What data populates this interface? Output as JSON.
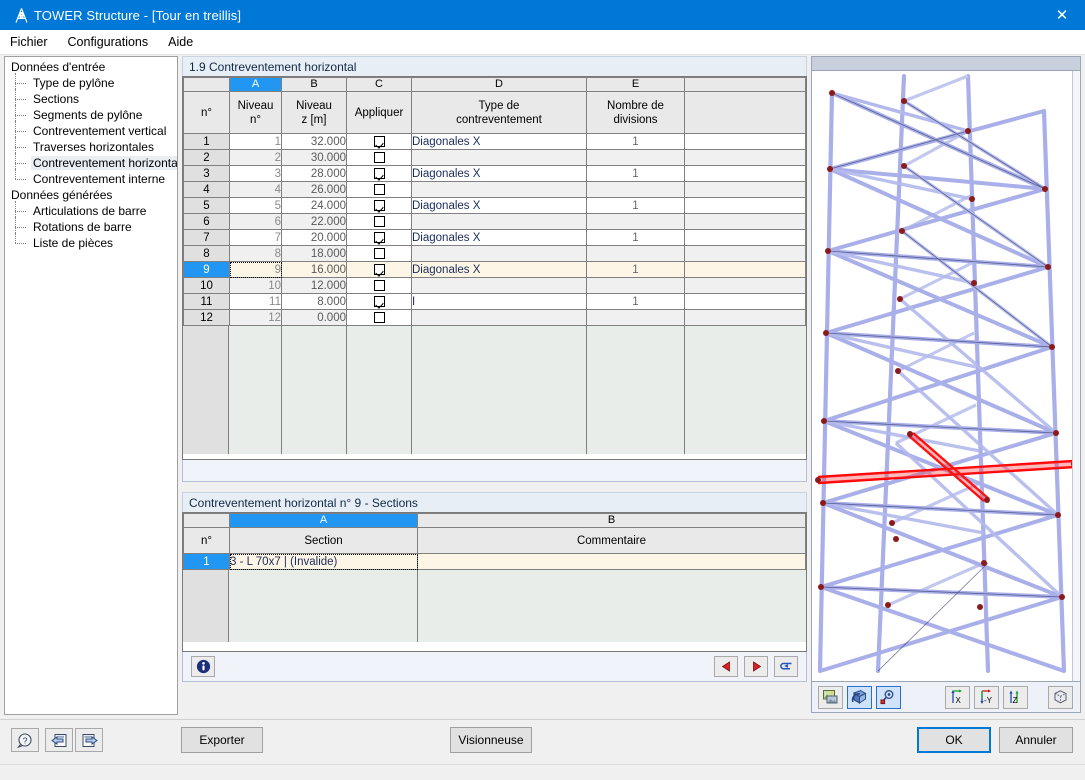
{
  "window": {
    "title": "TOWER Structure - [Tour en treillis]",
    "icon": "tower-icon",
    "close_label": "✕",
    "titlebar_color": "#0078d7"
  },
  "menu": {
    "items": [
      {
        "label": "Fichier",
        "name": "menu-fichier"
      },
      {
        "label": "Configurations",
        "name": "menu-configurations"
      },
      {
        "label": "Aide",
        "name": "menu-aide"
      }
    ]
  },
  "sidebar": {
    "groups": [
      {
        "label": "Données d'entrée",
        "items": [
          {
            "label": "Type de pylône",
            "selected": false
          },
          {
            "label": "Sections",
            "selected": false
          },
          {
            "label": "Segments de pylône",
            "selected": false
          },
          {
            "label": "Contreventement vertical",
            "selected": false
          },
          {
            "label": "Traverses horizontales",
            "selected": false
          },
          {
            "label": "Contreventement horizontal",
            "selected": true
          },
          {
            "label": "Contreventement interne",
            "selected": false
          }
        ]
      },
      {
        "label": "Données générées",
        "items": [
          {
            "label": "Articulations de barre",
            "selected": false
          },
          {
            "label": "Rotations de barre",
            "selected": false
          },
          {
            "label": "Liste de pièces",
            "selected": false
          }
        ]
      }
    ]
  },
  "main": {
    "section_title": "1.9 Contreventement horizontal",
    "grid": {
      "column_letters": [
        "",
        "A",
        "B",
        "C",
        "D",
        "E",
        ""
      ],
      "selected_column_letter": "A",
      "headers": {
        "rownum": "n°",
        "a_line1": "Niveau",
        "a_line2": "n°",
        "b_line1": "Niveau",
        "b_line2": "z [m]",
        "c_line1": "",
        "c_line2": "Appliquer",
        "d_line1": "Type de",
        "d_line2": "contreventement",
        "e_line1": "Nombre de",
        "e_line2": "divisions",
        "f": ""
      },
      "rows": [
        {
          "n": "1",
          "niveau": "1",
          "z": "32.000",
          "appliquer": true,
          "type": "Diagonales X",
          "divisions": "1",
          "selected": false
        },
        {
          "n": "2",
          "niveau": "2",
          "z": "30.000",
          "appliquer": false,
          "type": "",
          "divisions": "",
          "selected": false
        },
        {
          "n": "3",
          "niveau": "3",
          "z": "28.000",
          "appliquer": true,
          "type": "Diagonales X",
          "divisions": "1",
          "selected": false
        },
        {
          "n": "4",
          "niveau": "4",
          "z": "26.000",
          "appliquer": false,
          "type": "",
          "divisions": "",
          "selected": false
        },
        {
          "n": "5",
          "niveau": "5",
          "z": "24.000",
          "appliquer": true,
          "type": "Diagonales X",
          "divisions": "1",
          "selected": false
        },
        {
          "n": "6",
          "niveau": "6",
          "z": "22.000",
          "appliquer": false,
          "type": "",
          "divisions": "",
          "selected": false
        },
        {
          "n": "7",
          "niveau": "7",
          "z": "20.000",
          "appliquer": true,
          "type": "Diagonales X",
          "divisions": "1",
          "selected": false
        },
        {
          "n": "8",
          "niveau": "8",
          "z": "18.000",
          "appliquer": false,
          "type": "",
          "divisions": "",
          "selected": false
        },
        {
          "n": "9",
          "niveau": "9",
          "z": "16.000",
          "appliquer": true,
          "type": "Diagonales X",
          "divisions": "1",
          "selected": true
        },
        {
          "n": "10",
          "niveau": "10",
          "z": "12.000",
          "appliquer": false,
          "type": "",
          "divisions": "",
          "selected": false
        },
        {
          "n": "11",
          "niveau": "11",
          "z": "8.000",
          "appliquer": true,
          "type": "I",
          "divisions": "1",
          "selected": false
        },
        {
          "n": "12",
          "niveau": "12",
          "z": "0.000",
          "appliquer": false,
          "type": "",
          "divisions": "",
          "selected": false
        }
      ]
    },
    "sections_panel": {
      "title": "Contreventement horizontal n° 9  -  Sections",
      "column_letters": [
        "",
        "A",
        "B"
      ],
      "selected_column_letter": "A",
      "headers": {
        "rownum": "n°",
        "section": "Section",
        "comment": "Commentaire"
      },
      "rows": [
        {
          "n": "1",
          "section": "3 - L 70x7 | (Invalide)",
          "comment": "",
          "selected": true
        }
      ],
      "toolbar": {
        "info": "info-icon",
        "prev": "prev-record-icon",
        "next": "next-record-icon",
        "apply": "apply-icon"
      }
    }
  },
  "viewport": {
    "name": "tower-3d-view",
    "colors": {
      "member": "#a9afe8",
      "member_dark": "#8189d4",
      "node": "#8b1a1a",
      "highlight": "#ff0000"
    },
    "toolbar": [
      {
        "name": "render-image-button",
        "icon": "render-icon",
        "active": false
      },
      {
        "name": "rotate-view-button",
        "icon": "rotate-icon",
        "active": true
      },
      {
        "name": "zoom-pan-button",
        "icon": "zoom-pan-icon",
        "active": true
      },
      {
        "name": "view-x-button",
        "icon": "axis-x-icon",
        "label": "X",
        "active": false
      },
      {
        "name": "view-y-button",
        "icon": "axis-y-icon",
        "label": "-Y",
        "active": false
      },
      {
        "name": "view-z-button",
        "icon": "axis-z-icon",
        "label": "Z",
        "active": false
      },
      {
        "name": "view-iso-button",
        "icon": "cube-icon",
        "active": false
      }
    ]
  },
  "footer": {
    "help_icon": "help-icon",
    "import_icon": "import-icon",
    "export_icon": "export-icon",
    "exporter_label": "Exporter",
    "visionneuse_label": "Visionneuse",
    "ok_label": "OK",
    "cancel_label": "Annuler"
  }
}
